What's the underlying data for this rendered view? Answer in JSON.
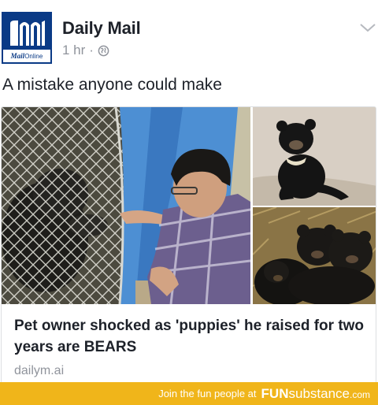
{
  "post": {
    "page_name": "Daily Mail",
    "timestamp": "1 hr",
    "separator": "·",
    "audience_icon": "globe-icon",
    "caption": "A mistake anyone could make",
    "logo": {
      "name": "mail-online-logo",
      "strip_mail": "Mail",
      "strip_online": "Online",
      "colors": {
        "navy": "#0a3a86"
      }
    }
  },
  "link_card": {
    "headline": "Pet owner shocked as 'puppies' he raised for two years are BEARS",
    "domain": "dailym.ai",
    "images": [
      "man-feeding-bear-photo",
      "sitting-bear-cub-photo",
      "bear-cubs-photo"
    ]
  },
  "footer": {
    "text": "Join the fun people at",
    "brand_bold": "FUN",
    "brand_rest": "substance",
    "brand_tld": ".com",
    "color": "#f0b51a"
  },
  "menu_icon": "chevron-down-icon"
}
